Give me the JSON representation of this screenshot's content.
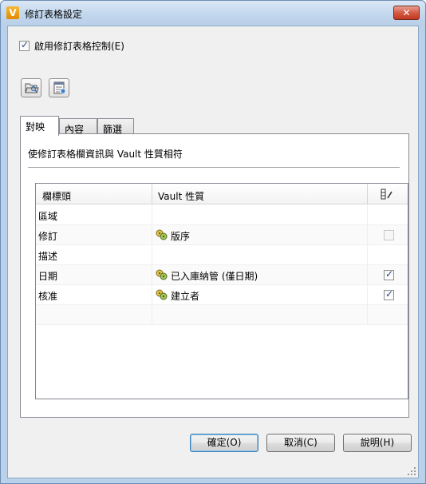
{
  "window": {
    "title": "修訂表格設定",
    "app_icon_letter": "V",
    "close_glyph": "✕"
  },
  "enable_control": {
    "label": "啟用修訂表格控制(E)",
    "checked": true
  },
  "toolbar": {
    "icons": [
      "open-folder-icon",
      "table-settings-icon"
    ]
  },
  "tabs": [
    {
      "label": "對映",
      "active": true
    },
    {
      "label": "內容",
      "active": false
    },
    {
      "label": "篩選",
      "active": false
    }
  ],
  "mapping": {
    "description": "使修訂表格欄資訊與 Vault 性質相符",
    "columns": {
      "col1": "欄標頭",
      "col2": "Vault 性質",
      "col3_icon": "column-edit-icon"
    },
    "rows": [
      {
        "header": "區域",
        "property": "",
        "checkbox": "none"
      },
      {
        "header": "修訂",
        "property": "版序",
        "checkbox": "disabled"
      },
      {
        "header": "描述",
        "property": "",
        "checkbox": "none"
      },
      {
        "header": "日期",
        "property": "已入庫納管 (僅日期)",
        "checkbox": "checked"
      },
      {
        "header": "核准",
        "property": "建立者",
        "checkbox": "checked"
      },
      {
        "header": "",
        "property": "",
        "checkbox": "none"
      }
    ]
  },
  "buttons": {
    "ok": "確定(O)",
    "cancel": "取消(C)",
    "help": "說明(H)"
  }
}
